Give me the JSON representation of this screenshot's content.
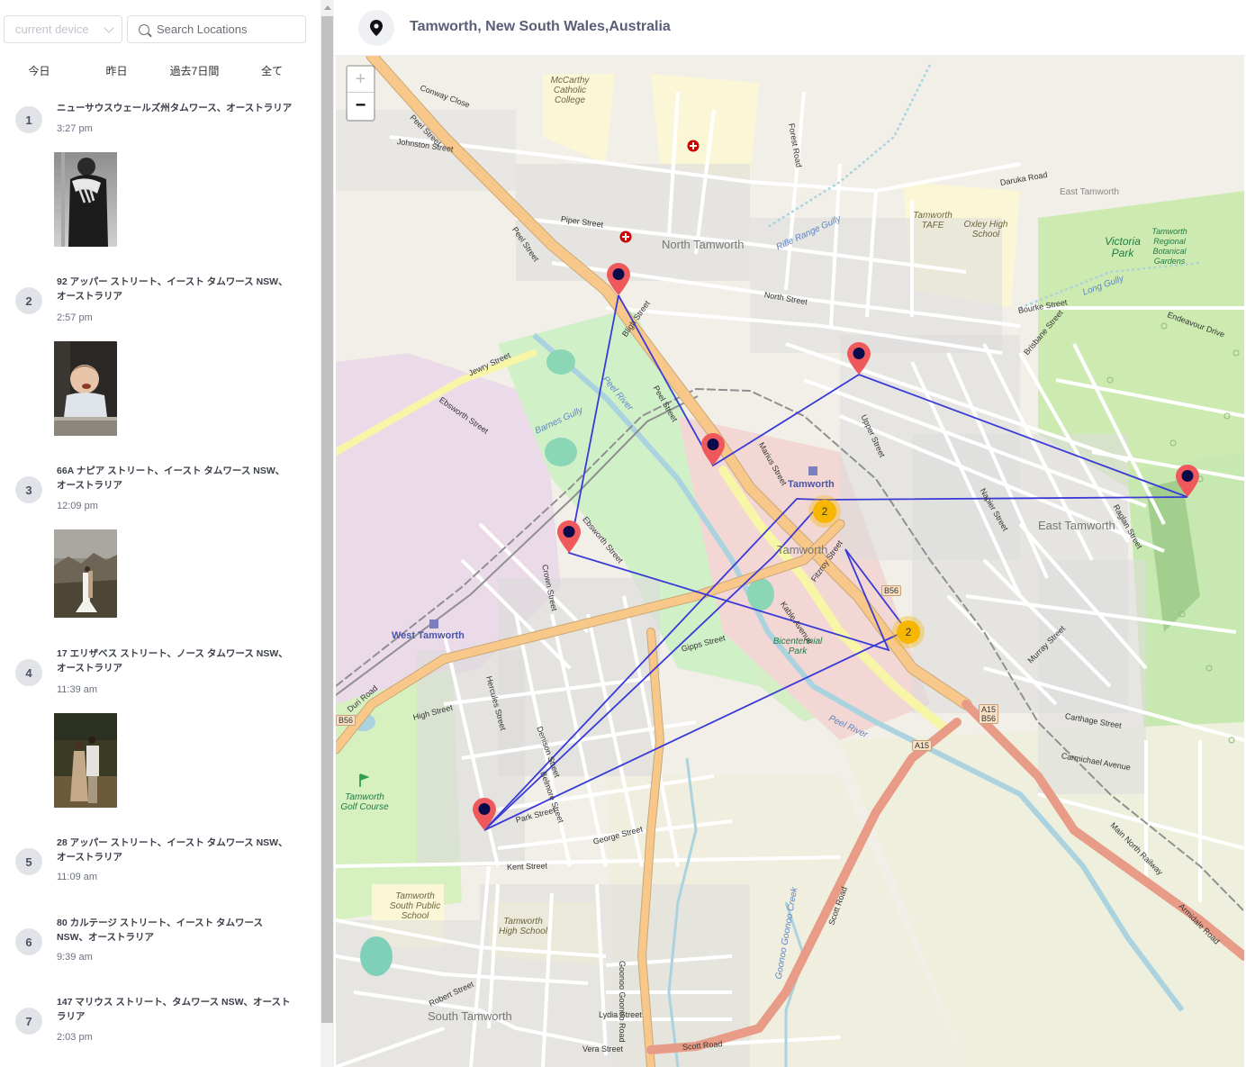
{
  "sidebar": {
    "device_select": {
      "value": "current device"
    },
    "search": {
      "placeholder": "Search Locations",
      "value": ""
    },
    "tabs": [
      {
        "label": "今日"
      },
      {
        "label": "昨日"
      },
      {
        "label": "過去7日間"
      },
      {
        "label": "全て"
      }
    ],
    "items": [
      {
        "index": "1",
        "address": "ニューサウスウェールズ州タムワース、オーストラリア",
        "time": "3:27 pm",
        "photo": "couple-embrace-bw"
      },
      {
        "index": "2",
        "address": "92 アッパー ストリート、イースト タムワース NSW、オーストラリア",
        "time": "2:57 pm",
        "photo": "laughing-baby"
      },
      {
        "index": "3",
        "address": "66A ナピア ストリート、イースト タムワース NSW、オーストラリア",
        "time": "12:09 pm",
        "photo": "wedding-mountains"
      },
      {
        "index": "4",
        "address": "17 エリザベス ストリート、ノース タムワース NSW、オーストラリア",
        "time": "11:39 am",
        "photo": "couple-field"
      },
      {
        "index": "5",
        "address": "28 アッパー ストリート、イースト タムワース NSW、オーストラリア",
        "time": "11:09 am",
        "photo": null
      },
      {
        "index": "6",
        "address": "80 カルテージ ストリート、イースト タムワース NSW、オーストラリア",
        "time": "9:39 am",
        "photo": null
      },
      {
        "index": "7",
        "address": "147 マリウス ストリート、タムワース NSW、オーストラリア",
        "time": "2:03 pm",
        "photo": null
      }
    ]
  },
  "header": {
    "icon": "map-pin-icon",
    "title": "Tamworth, New South Wales,Australia"
  },
  "map": {
    "zoom_in_label": "+",
    "zoom_out_label": "−",
    "route_color": "#3a3ad6",
    "marker_color": "#f0595c",
    "marker_dot_color": "#0a0a4a",
    "cluster_color": "#f7b600",
    "clusters": [
      {
        "count": "2"
      },
      {
        "count": "2"
      }
    ],
    "labels": {
      "north_tamworth": "North Tamworth",
      "tamworth_station": "Tamworth",
      "tamworth_center": "Tamworth",
      "east_tamworth": "East Tamworth",
      "east_tamworth_area": "East Tamworth",
      "west_tamworth": "West Tamworth",
      "south_tamworth": "South Tamworth",
      "victoria_park": "Victoria Park",
      "botanic_gardens": "Tamworth Regional Botanical Gardens",
      "bicentennial_park": "Bicentennial Park",
      "golf_course": "Tamworth Golf Course",
      "mccarthy": "McCarthy Catholic College",
      "tafe": "Tamworth TAFE",
      "oxley_high": "Oxley High School",
      "south_public": "Tamworth South Public School",
      "tamworth_high": "Tamworth High School",
      "peel_river": "Peel River",
      "peel_river_2": "Peel River",
      "barnes_gully": "Barnes Gully",
      "long_gully": "Long Gully",
      "rifle_range_gully": "Rifle Range Gully",
      "goonoo_creek": "Goonoo Goonoo Creek",
      "peel_street": "Peel Street",
      "peel_street_2": "Peel Street",
      "peel_street_3": "Peel Street",
      "marius_street": "Marius Street",
      "johnston_street": "Johnston Street",
      "piper_street": "Piper Street",
      "north_street": "North Street",
      "bligh_street": "Bligh Street",
      "jewry_street": "Jewry Street",
      "ebsworth_street": "Ebsworth Street",
      "ebsworth_street_2": "Ebsworth Street",
      "kent_street": "Kent Street",
      "gipps_street": "Gipps Street",
      "scott_road": "Scott Road",
      "scott_road_2": "Scott Road",
      "goonoo_road": "Goonoo Goonoo Road",
      "duri_road": "Duri Road",
      "daruka_road": "Daruka Road",
      "carthage_street": "Carthage Street",
      "upper_street": "Upper Street",
      "brisbane_street": "Brisbane Street",
      "bourke_street": "Bourke Street",
      "main_north_railway": "Main North Railway",
      "armidale_road": "Armidale Road",
      "forest_road": "Forest Road",
      "conway_close": "Conway Close",
      "robert_street": "Robert Street",
      "vera_street": "Vera Street",
      "lydia_street": "Lydia Street",
      "fitzroy_street": "Fitzroy Street",
      "kable_avenue": "Kable Avenue",
      "denison_street": "Denison Street",
      "crown_street": "Crown Street",
      "belmore_street": "Belmore Street",
      "hercules_street": "Hercules Street",
      "high_street": "High Street",
      "park_street": "Park Street",
      "george_street": "George Street",
      "endeavour_drive": "Endeavour Drive",
      "raglan_street": "Raglan Street",
      "napier_street": "Napier Street",
      "carmichael_avenue": "Carmichael Avenue",
      "murray_street": "Murray Street"
    },
    "shields": {
      "b56_center": "B56",
      "a15_b56": "A15\nB56",
      "a15": "A15",
      "b56_west": "B56"
    }
  }
}
